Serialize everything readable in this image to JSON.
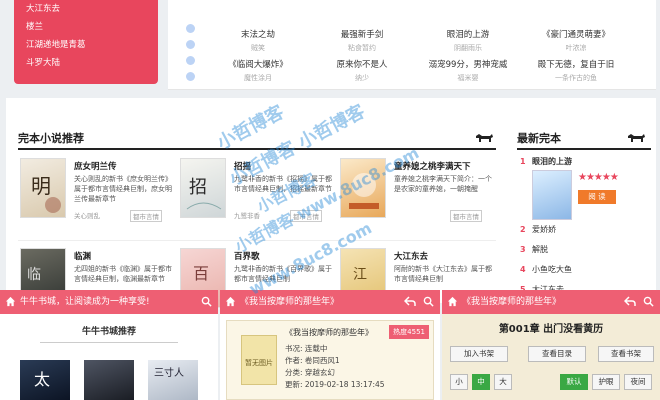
{
  "top": {
    "pink_menu": [
      "大江东去",
      "楼兰",
      "江湖递地是青葛",
      "斗罗大陆"
    ],
    "titles_row1": [
      {
        "title": "末法之劫",
        "author": "贼笑"
      },
      {
        "title": "最强新手剑",
        "author": "粘食暂约"
      },
      {
        "title": "眼泪的上游",
        "author": "阴翻雨乐"
      },
      {
        "title": "《豪门通灵萌妻》",
        "author": "叶浓凉"
      }
    ],
    "titles_row2": [
      {
        "title": "《临阅大爆炸》",
        "author": "魔性涂月"
      },
      {
        "title": "原来你不是人",
        "author": "纳少"
      },
      {
        "title": "溺宠99分，男神宠威",
        "author": "福米婴"
      },
      {
        "title": "殿下无德，复自于旧",
        "author": "一条作古的鱼"
      }
    ]
  },
  "finished": {
    "heading": "完本小说推荐",
    "books": [
      {
        "title": "庶女明兰传",
        "desc": "关心则乱的新书《庶女明兰传》属于都市言情经典巨制，庶女明兰传最新章节",
        "author": "关心则乱",
        "category": "都市言情"
      },
      {
        "title": "招摇",
        "desc": "九鹭非香的新书《招摇》属于都市言情经典巨制，招摇最新章节",
        "author": "九鹭非香",
        "category": "都市言情"
      },
      {
        "title": "童养媳之桃李满天下",
        "desc": "童养媳之桃李满天下简介：一个是农家的童养媳，一朝掩醒",
        "author": "",
        "category": "都市言情"
      },
      {
        "title": "临渊",
        "desc": "尤四姐的新书《临渊》属于都市言情经典巨制，临渊最新章节",
        "author": "",
        "category": ""
      },
      {
        "title": "百界歌",
        "desc": "九鹭非香的新书《百界歌》属于都市言情经典巨制",
        "author": "",
        "category": ""
      },
      {
        "title": "大江东去",
        "desc": "阿耐的新书《大江东去》属于都市言情经典巨制",
        "author": "",
        "category": ""
      }
    ]
  },
  "latest": {
    "heading": "最新完本",
    "items": [
      {
        "rank": "1",
        "title": "眼泪的上游"
      },
      {
        "rank": "2",
        "title": "爱娇娇"
      },
      {
        "rank": "3",
        "title": "解脱"
      },
      {
        "rank": "4",
        "title": "小鱼吃大鱼"
      },
      {
        "rank": "5",
        "title": "大江东去"
      }
    ],
    "stars": "★★★★★",
    "read_label": "阅 读"
  },
  "mobile1": {
    "header": "牛牛书城，让阅读成为一种享受!",
    "section_title": "牛牛书城推荐",
    "covers": [
      "太",
      "",
      "三寸人"
    ]
  },
  "mobile2": {
    "header": "《我当按摩师的那些年》",
    "book_title": "《我当按摩师的那些年》",
    "hot": "热度4551",
    "cover_text": "暂无图片",
    "lines": [
      "书况: 连载中",
      "作者: 卷同西风1",
      "分类: 穿越玄幻",
      "更新: 2019-02-18 13:17:45"
    ]
  },
  "mobile3": {
    "header": "《我当按摩师的那些年》",
    "chapter": "第001章 出门没看黄历",
    "btn_add": "加入书架",
    "btn_toc": "查看目录",
    "btn_shelf": "查看书架",
    "font_small": "小",
    "font_mid": "中",
    "font_big": "大",
    "theme_default": "默认",
    "theme_eye": "护眼",
    "theme_night": "夜间"
  },
  "watermark": {
    "line1": "小哲博客",
    "line2": "小哲博客 小哲博客",
    "line3": "小哲博客",
    "line4": "小哲博客 www.8uc8.com",
    "line5": "www.8uc8.com"
  },
  "colors": {
    "accent": "#e8465d",
    "mobile_header": "#ee5f73",
    "read_btn": "#f07a2a",
    "watermark": "#2f8dd8"
  }
}
